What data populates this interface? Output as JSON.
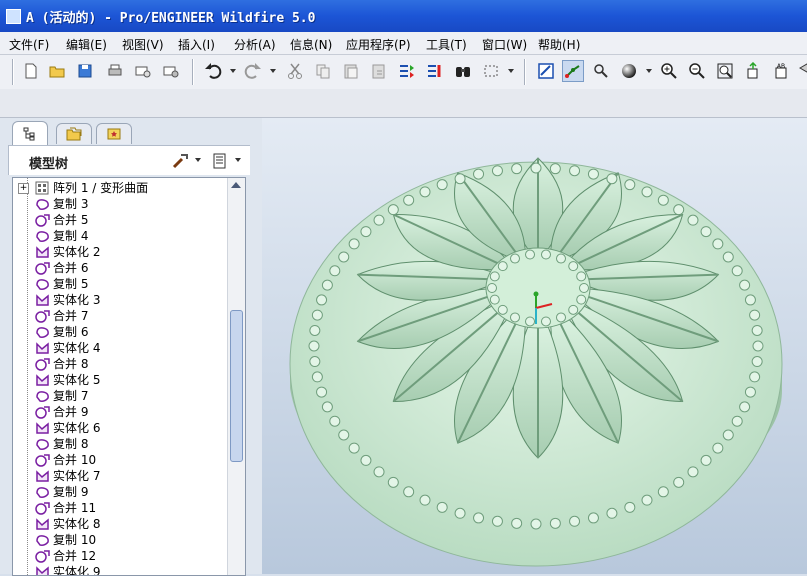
{
  "window": {
    "title": "A (活动的) - Pro/ENGINEER Wildfire 5.0"
  },
  "menubar": {
    "items": [
      "文件(F)",
      "编辑(E)",
      "视图(V)",
      "插入(I)",
      "分析(A)",
      "信息(N)",
      "应用程序(P)",
      "工具(T)",
      "窗口(W)",
      "帮助(H)"
    ]
  },
  "toolbar": {
    "icons": [
      "new-file-icon",
      "open-folder-icon",
      "save-icon",
      "print-icon",
      "email-icon",
      "email-attach-icon",
      "undo-icon",
      "redo-icon",
      "cut-icon",
      "copy-icon",
      "paste-icon",
      "paste-special-icon",
      "regenerate-icon",
      "regen-manager-icon",
      "find-icon",
      "select-box-icon",
      "repaint-icon",
      "spin-center-icon",
      "orient-mode-icon",
      "shading-icon",
      "zoom-in-icon",
      "zoom-out-icon",
      "refit-icon",
      "reorient-icon",
      "saved-views-icon",
      "layers-icon"
    ]
  },
  "navigator": {
    "tabs": [
      "model-tree-tab",
      "folder-browser-tab",
      "favorites-tab"
    ],
    "title": "模型树",
    "items": [
      {
        "label": "阵列 1 / 变形曲面",
        "type": "pattern"
      },
      {
        "label": "复制 3",
        "type": "copy"
      },
      {
        "label": "合并 5",
        "type": "merge"
      },
      {
        "label": "复制 4",
        "type": "copy"
      },
      {
        "label": "实体化 2",
        "type": "solidify"
      },
      {
        "label": "合并 6",
        "type": "merge"
      },
      {
        "label": "复制 5",
        "type": "copy"
      },
      {
        "label": "实体化 3",
        "type": "solidify"
      },
      {
        "label": "合并 7",
        "type": "merge"
      },
      {
        "label": "复制 6",
        "type": "copy"
      },
      {
        "label": "实体化 4",
        "type": "solidify"
      },
      {
        "label": "合并 8",
        "type": "merge"
      },
      {
        "label": "实体化 5",
        "type": "solidify"
      },
      {
        "label": "复制 7",
        "type": "copy"
      },
      {
        "label": "合并 9",
        "type": "merge"
      },
      {
        "label": "实体化 6",
        "type": "solidify"
      },
      {
        "label": "复制 8",
        "type": "copy"
      },
      {
        "label": "合并 10",
        "type": "merge"
      },
      {
        "label": "实体化 7",
        "type": "solidify"
      },
      {
        "label": "复制 9",
        "type": "copy"
      },
      {
        "label": "合并 11",
        "type": "merge"
      },
      {
        "label": "实体化 8",
        "type": "solidify"
      },
      {
        "label": "复制 10",
        "type": "copy"
      },
      {
        "label": "合并 12",
        "type": "merge"
      },
      {
        "label": "实体化 9",
        "type": "solidify"
      }
    ]
  },
  "colors": {
    "titlebar": "#1c55d6",
    "model_fill": "#c8ead2",
    "model_edge": "#5f8f6d",
    "tree_icon": "#7a1fa2",
    "viewport_bg": "#c9d6e6"
  }
}
